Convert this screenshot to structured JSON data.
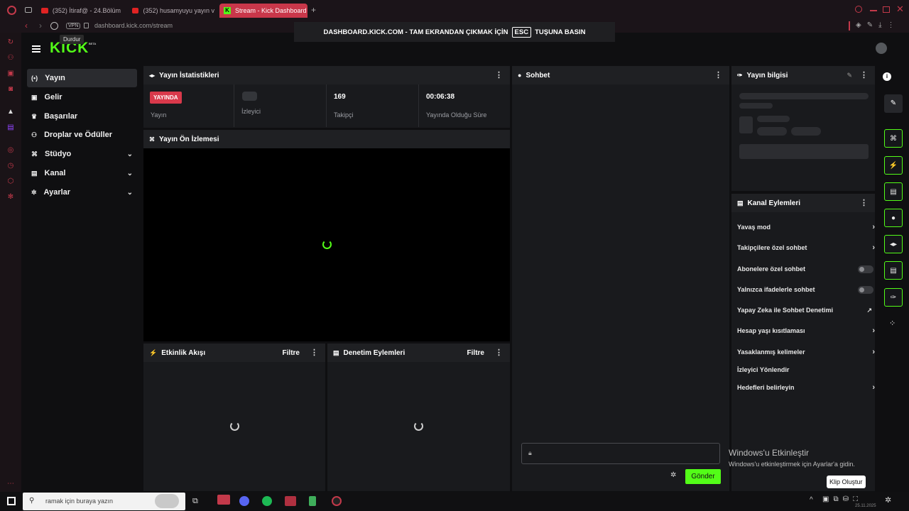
{
  "browser": {
    "tabs": [
      {
        "label": "(352) İtiraf@ - 24.Bölüm"
      },
      {
        "label": "(352) husamyuyu yayın v"
      },
      {
        "label": "Stream - Kick Dashboard"
      }
    ],
    "new_tab": "+",
    "url": "dashboard.kick.com/stream",
    "vpn_badge": "VPN",
    "tooltip_stop": "Durdur",
    "fullscreen_notice_pre": "DASHBOARD.KICK.COM - TAM EKRANDAN ÇIKMAK İÇİN",
    "fullscreen_key": "ESC",
    "fullscreen_notice_post": "TUŞUNA BASIN"
  },
  "brand": {
    "logo": "KICK",
    "beta": "BETA"
  },
  "nav": {
    "items": [
      {
        "label": "Yayın",
        "icon": "broadcast-icon"
      },
      {
        "label": "Gelir",
        "icon": "revenue-icon"
      },
      {
        "label": "Başarılar",
        "icon": "trophy-icon"
      },
      {
        "label": "Droplar ve Ödüller",
        "icon": "gift-icon"
      },
      {
        "label": "Stüdyo",
        "icon": "studio-icon"
      },
      {
        "label": "Kanal",
        "icon": "channel-icon"
      },
      {
        "label": "Ayarlar",
        "icon": "settings-icon"
      }
    ]
  },
  "stats": {
    "title": "Yayın İstatistikleri",
    "live_badge": "YAYINDA",
    "live_label": "Yayın",
    "viewers_label": "İzleyici",
    "followers_value": "169",
    "followers_label": "Takipçi",
    "uptime_value": "00:06:38",
    "uptime_label": "Yayında Olduğu Süre"
  },
  "preview": {
    "title": "Yayın Ön İzlemesi"
  },
  "activity": {
    "title": "Etkinlik Akışı",
    "filter": "Filtre"
  },
  "moderation": {
    "title": "Denetim Eylemleri",
    "filter": "Filtre"
  },
  "chat": {
    "title": "Sohbet",
    "send_label": "Gönder"
  },
  "stream_info": {
    "title": "Yayın bilgisi"
  },
  "channel_actions": {
    "title": "Kanal Eylemleri",
    "items": [
      {
        "label": "Yavaş mod"
      },
      {
        "label": "Takipçilere özel sohbet"
      },
      {
        "label": "Abonelere özel sohbet"
      },
      {
        "label": "Yalnızca ifadelerle sohbet"
      },
      {
        "label": "Yapay Zeka ile Sohbet Denetimi"
      },
      {
        "label": "Hesap yaşı kısıtlaması"
      },
      {
        "label": "Yasaklanmış kelimeler"
      },
      {
        "label": "İzleyici Yönlendir"
      },
      {
        "label": "Hedefleri belirleyin"
      }
    ]
  },
  "windows": {
    "activate_title": "Windows'u Etkinleştir",
    "activate_sub": "Windows'u etkinleştirmek için Ayarlar'a gidin.",
    "search_placeholder": "ramak için buraya yazın",
    "clip_tooltip": "Klip Oluştur",
    "date": "25.11.2025"
  },
  "colors": {
    "accent": "#53fc18",
    "live": "#d9394b",
    "browser": "#c3394a"
  }
}
